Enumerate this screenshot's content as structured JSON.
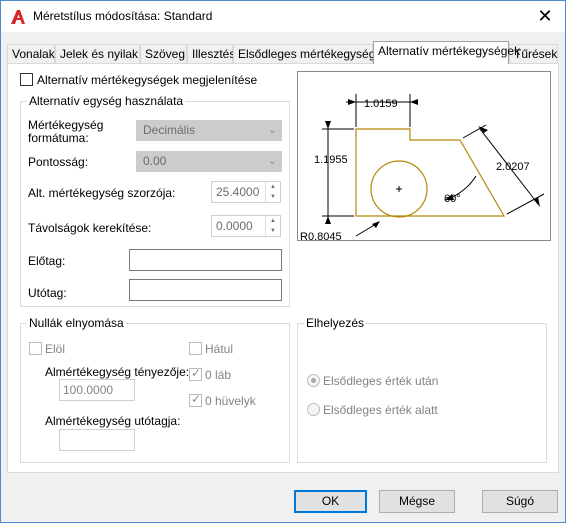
{
  "window": {
    "title": "Méretstílus módosítása: Standard",
    "close_glyph": "✕"
  },
  "tabs": [
    {
      "label": "Vonalak"
    },
    {
      "label": "Jelek és nyilak"
    },
    {
      "label": "Szöveg"
    },
    {
      "label": "Illesztés"
    },
    {
      "label": "Elsődleges mértékegységek"
    },
    {
      "label": "Alternatív mértékegységek"
    },
    {
      "label": "Tűrések"
    }
  ],
  "active_tab": "Alternatív mértékegységek",
  "display_alt": {
    "label": "Alternatív mértékegységek megjelenítése",
    "checked": false
  },
  "alt_units": {
    "group_label": "Alternatív egység használata",
    "unit_format_label": "Mértékegység formátuma:",
    "unit_format_value": "Decimális",
    "precision_label": "Pontosság:",
    "precision_value": "0.00",
    "multiplier_label": "Alt. mértékegység szorzója:",
    "multiplier_value": "25.4000",
    "round_label": "Távolságok kerekítése:",
    "round_value": "0.0000",
    "prefix_label": "Előtag:",
    "prefix_value": "",
    "suffix_label": "Utótag:",
    "suffix_value": ""
  },
  "zero_suppression": {
    "group_label": "Nullák elnyomása",
    "leading_label": "Elöl",
    "leading_checked": false,
    "trailing_label": "Hátul",
    "trailing_checked": false,
    "sub_factor_label": "Almértékegység tényezője:",
    "sub_factor_value": "100.0000",
    "zero_feet_label": "0 láb",
    "zero_feet_checked": true,
    "zero_inches_label": "0 hüvelyk",
    "zero_inches_checked": true,
    "sub_suffix_label": "Almértékegység utótagja:",
    "sub_suffix_value": ""
  },
  "placement": {
    "group_label": "Elhelyezés",
    "after_primary_label": "Elsődleges érték után",
    "after_primary_selected": true,
    "below_primary_label": "Elsődleges érték alatt",
    "below_primary_selected": false
  },
  "preview": {
    "dim_top": "1.0159",
    "dim_left": "1.1955",
    "dim_right": "2.0207",
    "dim_angle": "60°",
    "dim_radius": "R0.8045"
  },
  "buttons": {
    "ok": "OK",
    "cancel": "Mégse",
    "help": "Súgó"
  },
  "colors": {
    "accent": "#0078d7",
    "app_icon": "#d62828",
    "preview_outline": "#b8860b"
  }
}
